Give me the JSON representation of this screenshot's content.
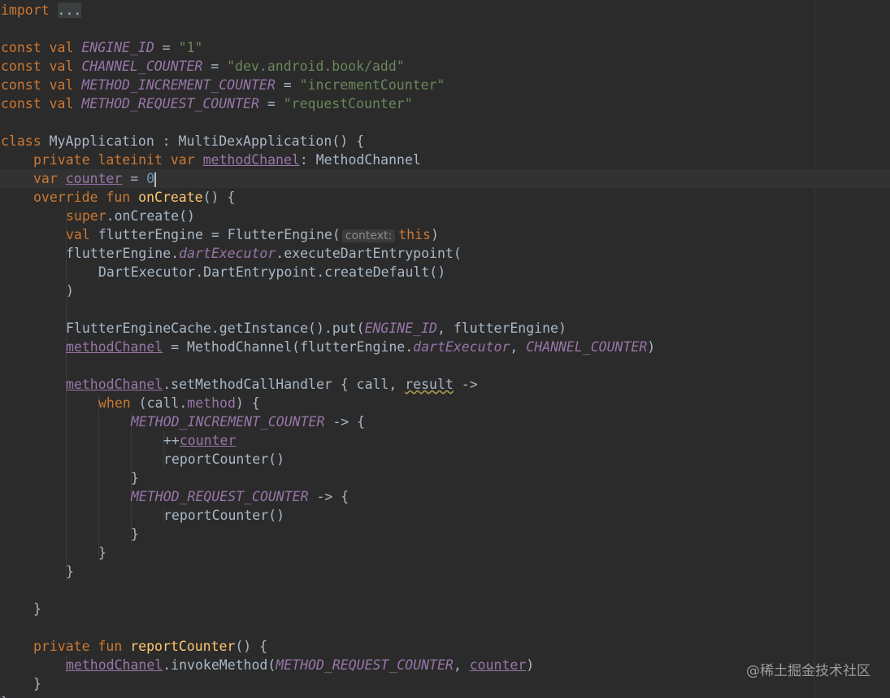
{
  "code": {
    "lines": [
      {
        "indent": 0,
        "tokens": [
          {
            "t": "import ",
            "c": "kw"
          },
          {
            "t": "...",
            "c": "fold"
          }
        ]
      },
      {
        "indent": 0,
        "tokens": []
      },
      {
        "indent": 0,
        "tokens": [
          {
            "t": "const val ",
            "c": "kw"
          },
          {
            "t": "ENGINE_ID",
            "c": "cst"
          },
          {
            "t": " = ",
            "c": "plain"
          },
          {
            "t": "\"1\"",
            "c": "str"
          }
        ]
      },
      {
        "indent": 0,
        "tokens": [
          {
            "t": "const val ",
            "c": "kw"
          },
          {
            "t": "CHANNEL_COUNTER",
            "c": "cst"
          },
          {
            "t": " = ",
            "c": "plain"
          },
          {
            "t": "\"dev.android.book/add\"",
            "c": "str"
          }
        ]
      },
      {
        "indent": 0,
        "tokens": [
          {
            "t": "const val ",
            "c": "kw"
          },
          {
            "t": "METHOD_INCREMENT_COUNTER",
            "c": "cst"
          },
          {
            "t": " = ",
            "c": "plain"
          },
          {
            "t": "\"incrementCounter\"",
            "c": "str"
          }
        ]
      },
      {
        "indent": 0,
        "tokens": [
          {
            "t": "const val ",
            "c": "kw"
          },
          {
            "t": "METHOD_REQUEST_COUNTER",
            "c": "cst"
          },
          {
            "t": " = ",
            "c": "plain"
          },
          {
            "t": "\"requestCounter\"",
            "c": "str"
          }
        ]
      },
      {
        "indent": 0,
        "tokens": []
      },
      {
        "indent": 0,
        "tokens": [
          {
            "t": "class ",
            "c": "kw"
          },
          {
            "t": "MyApplication : MultiDexApplication() {",
            "c": "plain"
          }
        ]
      },
      {
        "indent": 1,
        "tokens": [
          {
            "t": "private lateinit var ",
            "c": "kw"
          },
          {
            "t": "methodChanel",
            "c": "propu"
          },
          {
            "t": ": MethodChannel",
            "c": "plain"
          }
        ]
      },
      {
        "indent": 1,
        "tokens": [
          {
            "t": "var ",
            "c": "kw"
          },
          {
            "t": "counter",
            "c": "propu"
          },
          {
            "t": " = ",
            "c": "plain"
          },
          {
            "t": "0",
            "c": "num"
          },
          {
            "t": "",
            "c": "caret"
          }
        ]
      },
      {
        "indent": 1,
        "tokens": [
          {
            "t": "override fun ",
            "c": "kw"
          },
          {
            "t": "onCreate",
            "c": "fn"
          },
          {
            "t": "() {",
            "c": "plain"
          }
        ]
      },
      {
        "indent": 2,
        "tokens": [
          {
            "t": "super",
            "c": "kw"
          },
          {
            "t": ".onCreate()",
            "c": "plain"
          }
        ]
      },
      {
        "indent": 2,
        "tokens": [
          {
            "t": "val ",
            "c": "kw"
          },
          {
            "t": "flutterEngine = FlutterEngine(",
            "c": "plain"
          },
          {
            "t": "context:",
            "c": "hint"
          },
          {
            "t": "this",
            "c": "kw"
          },
          {
            "t": ")",
            "c": "plain"
          }
        ]
      },
      {
        "indent": 2,
        "tokens": [
          {
            "t": "flutterEngine.",
            "c": "plain"
          },
          {
            "t": "dartExecutor",
            "c": "dexec"
          },
          {
            "t": ".executeDartEntrypoint(",
            "c": "plain"
          }
        ]
      },
      {
        "indent": 3,
        "tokens": [
          {
            "t": "DartExecutor.DartEntrypoint.createDefault()",
            "c": "plain"
          }
        ]
      },
      {
        "indent": 2,
        "tokens": [
          {
            "t": ")",
            "c": "plain"
          }
        ]
      },
      {
        "indent": 0,
        "tokens": []
      },
      {
        "indent": 2,
        "tokens": [
          {
            "t": "FlutterEngineCache.getInstance().put(",
            "c": "plain"
          },
          {
            "t": "ENGINE_ID",
            "c": "cst"
          },
          {
            "t": ", flutterEngine)",
            "c": "plain"
          }
        ]
      },
      {
        "indent": 2,
        "tokens": [
          {
            "t": "methodChanel",
            "c": "propu"
          },
          {
            "t": " = MethodChannel(flutterEngine.",
            "c": "plain"
          },
          {
            "t": "dartExecutor",
            "c": "dexec"
          },
          {
            "t": ", ",
            "c": "plain"
          },
          {
            "t": "CHANNEL_COUNTER",
            "c": "cst"
          },
          {
            "t": ")",
            "c": "plain"
          }
        ]
      },
      {
        "indent": 0,
        "tokens": []
      },
      {
        "indent": 2,
        "tokens": [
          {
            "t": "methodChanel",
            "c": "propu"
          },
          {
            "t": ".setMethodCallHandler { call, ",
            "c": "plain"
          },
          {
            "t": "result",
            "c": "warn"
          },
          {
            "t": " ->",
            "c": "plain"
          }
        ]
      },
      {
        "indent": 3,
        "tokens": [
          {
            "t": "when",
            "c": "kw"
          },
          {
            "t": " (call.",
            "c": "plain"
          },
          {
            "t": "method",
            "c": "prop"
          },
          {
            "t": ") {",
            "c": "plain"
          }
        ]
      },
      {
        "indent": 4,
        "tokens": [
          {
            "t": "METHOD_INCREMENT_COUNTER",
            "c": "cst"
          },
          {
            "t": " -> {",
            "c": "plain"
          }
        ]
      },
      {
        "indent": 5,
        "tokens": [
          {
            "t": "++",
            "c": "plain"
          },
          {
            "t": "counter",
            "c": "propu"
          }
        ]
      },
      {
        "indent": 5,
        "tokens": [
          {
            "t": "reportCounter()",
            "c": "plain"
          }
        ]
      },
      {
        "indent": 4,
        "tokens": [
          {
            "t": "}",
            "c": "plain"
          }
        ]
      },
      {
        "indent": 4,
        "tokens": [
          {
            "t": "METHOD_REQUEST_COUNTER",
            "c": "cst"
          },
          {
            "t": " -> {",
            "c": "plain"
          }
        ]
      },
      {
        "indent": 5,
        "tokens": [
          {
            "t": "reportCounter()",
            "c": "plain"
          }
        ]
      },
      {
        "indent": 4,
        "tokens": [
          {
            "t": "}",
            "c": "plain"
          }
        ]
      },
      {
        "indent": 3,
        "tokens": [
          {
            "t": "}",
            "c": "plain"
          }
        ]
      },
      {
        "indent": 2,
        "tokens": [
          {
            "t": "}",
            "c": "plain"
          }
        ]
      },
      {
        "indent": 0,
        "tokens": []
      },
      {
        "indent": 1,
        "tokens": [
          {
            "t": "}",
            "c": "plain"
          }
        ]
      },
      {
        "indent": 0,
        "tokens": []
      },
      {
        "indent": 1,
        "tokens": [
          {
            "t": "private fun ",
            "c": "kw"
          },
          {
            "t": "reportCounter",
            "c": "fn"
          },
          {
            "t": "() {",
            "c": "plain"
          }
        ]
      },
      {
        "indent": 2,
        "tokens": [
          {
            "t": "methodChanel",
            "c": "propu"
          },
          {
            "t": ".invokeMethod(",
            "c": "plain"
          },
          {
            "t": "METHOD_REQUEST_COUNTER",
            "c": "cst"
          },
          {
            "t": ", ",
            "c": "plain"
          },
          {
            "t": "counter",
            "c": "propu"
          },
          {
            "t": ")",
            "c": "plain"
          }
        ]
      },
      {
        "indent": 1,
        "tokens": [
          {
            "t": "}",
            "c": "plain"
          }
        ]
      },
      {
        "indent": 0,
        "tokens": [
          {
            "t": "}",
            "c": "plain"
          }
        ]
      }
    ]
  },
  "watermark": "@稀土掘金技术社区",
  "colors": {
    "background": "#2b2b2b",
    "keyword": "#cc7832",
    "string": "#6a8759",
    "constant": "#9876aa",
    "function": "#ffc66d",
    "number": "#6897bb",
    "text": "#a9b7c6"
  }
}
